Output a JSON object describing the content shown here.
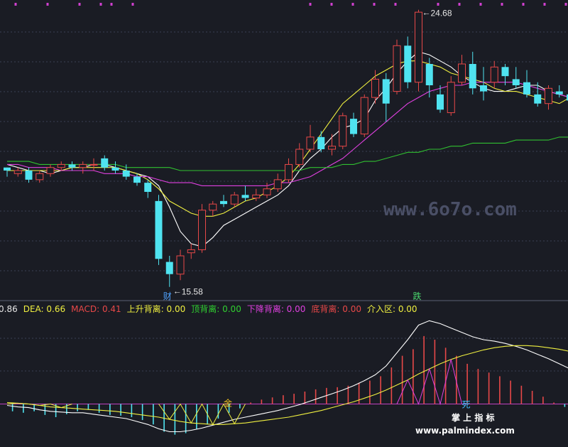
{
  "chart_data": [
    {
      "type": "candlestick",
      "title": "",
      "price_labels": {
        "high": "24.68",
        "low": "15.58"
      },
      "event_markers": [
        {
          "text": "财",
          "color": "#4fa3ff"
        },
        {
          "text": "跌",
          "color": "#4ad66d"
        }
      ],
      "ohlc": [
        [
          19.5,
          19.5,
          19.2,
          19.4
        ],
        [
          19.3,
          19.5,
          19.2,
          19.4
        ],
        [
          19.4,
          19.5,
          19.0,
          19.1
        ],
        [
          19.1,
          19.4,
          19.0,
          19.3
        ],
        [
          19.3,
          19.6,
          19.2,
          19.5
        ],
        [
          19.5,
          19.7,
          19.4,
          19.6
        ],
        [
          19.6,
          19.7,
          19.4,
          19.5
        ],
        [
          19.5,
          19.7,
          19.3,
          19.6
        ],
        [
          19.6,
          19.8,
          19.4,
          19.6
        ],
        [
          19.8,
          19.9,
          19.4,
          19.5
        ],
        [
          19.5,
          19.7,
          19.3,
          19.4
        ],
        [
          19.4,
          19.6,
          19.1,
          19.2
        ],
        [
          19.2,
          19.3,
          18.9,
          19.0
        ],
        [
          19.0,
          19.1,
          18.5,
          18.7
        ],
        [
          18.4,
          18.6,
          16.3,
          16.5
        ],
        [
          16.4,
          16.6,
          15.58,
          16.0
        ],
        [
          16.0,
          16.8,
          15.8,
          16.6
        ],
        [
          16.7,
          17.0,
          16.5,
          16.8
        ],
        [
          16.8,
          18.3,
          16.7,
          18.1
        ],
        [
          18.1,
          18.4,
          17.9,
          18.3
        ],
        [
          18.4,
          18.6,
          18.2,
          18.3
        ],
        [
          18.3,
          18.7,
          18.2,
          18.6
        ],
        [
          18.6,
          18.9,
          18.4,
          18.5
        ],
        [
          18.5,
          18.8,
          18.4,
          18.6
        ],
        [
          18.6,
          19.0,
          18.5,
          18.8
        ],
        [
          18.8,
          19.3,
          18.7,
          19.1
        ],
        [
          19.1,
          19.8,
          19.0,
          19.6
        ],
        [
          19.6,
          20.3,
          19.5,
          20.1
        ],
        [
          20.1,
          20.9,
          20.0,
          20.5
        ],
        [
          20.5,
          20.7,
          20.0,
          20.1
        ],
        [
          20.1,
          20.6,
          19.9,
          20.2
        ],
        [
          20.2,
          21.3,
          20.1,
          21.2
        ],
        [
          21.1,
          21.3,
          20.5,
          20.6
        ],
        [
          20.6,
          21.9,
          20.5,
          21.8
        ],
        [
          21.8,
          22.7,
          21.6,
          22.4
        ],
        [
          22.4,
          22.6,
          21.0,
          21.6
        ],
        [
          22.0,
          23.7,
          21.9,
          23.5
        ],
        [
          23.5,
          23.8,
          22.1,
          22.3
        ],
        [
          22.3,
          24.68,
          22.0,
          24.6
        ],
        [
          22.9,
          23.1,
          21.8,
          22.2
        ],
        [
          21.9,
          22.2,
          21.3,
          21.4
        ],
        [
          21.3,
          22.5,
          21.2,
          22.3
        ],
        [
          22.3,
          23.2,
          22.2,
          22.9
        ],
        [
          22.9,
          23.3,
          21.9,
          22.1
        ],
        [
          22.2,
          22.8,
          21.7,
          22.0
        ],
        [
          22.3,
          23.0,
          22.1,
          22.8
        ],
        [
          22.8,
          22.9,
          22.2,
          22.5
        ],
        [
          22.4,
          22.8,
          22.1,
          22.2
        ],
        [
          22.3,
          22.7,
          21.8,
          21.9
        ],
        [
          21.9,
          22.3,
          21.5,
          21.6
        ],
        [
          21.6,
          22.2,
          21.4,
          22.1
        ],
        [
          22.0,
          22.2,
          21.8,
          21.9
        ],
        [
          21.9,
          22.2,
          21.6,
          21.7
        ],
        [
          21.6,
          22.0,
          21.5,
          21.8
        ],
        [
          21.6,
          21.8,
          21.4,
          21.5
        ],
        [
          21.5,
          21.7,
          21.4,
          21.7
        ],
        [
          21.7,
          22.8,
          21.6,
          22.7
        ]
      ],
      "series": [
        {
          "color": "#ffffff",
          "values": [
            19.6,
            19.5,
            19.4,
            19.4,
            19.3,
            19.4,
            19.5,
            19.5,
            19.6,
            19.6,
            19.5,
            19.4,
            19.3,
            19.2,
            18.9,
            18.2,
            17.4,
            17.0,
            16.9,
            17.2,
            17.6,
            17.8,
            18.0,
            18.2,
            18.4,
            18.6,
            18.9,
            19.4,
            19.8,
            20.1,
            20.5,
            20.8,
            20.9,
            21.1,
            21.7,
            22.1,
            22.6,
            23.0,
            23.3,
            23.2,
            23.0,
            22.8,
            22.5,
            22.3,
            22.1,
            22.0,
            22.0,
            22.1,
            22.2,
            22.2,
            22.0,
            21.9,
            21.8,
            21.8,
            21.7,
            21.7,
            21.8
          ]
        },
        {
          "color": "#f0f040",
          "values": [
            19.4,
            19.4,
            19.4,
            19.4,
            19.4,
            19.4,
            19.5,
            19.5,
            19.5,
            19.5,
            19.5,
            19.4,
            19.3,
            19.1,
            18.8,
            18.4,
            18.2,
            18.0,
            17.9,
            17.9,
            18.0,
            18.2,
            18.4,
            18.5,
            18.7,
            18.9,
            19.2,
            19.6,
            20.1,
            20.6,
            21.1,
            21.6,
            21.9,
            22.2,
            22.5,
            22.7,
            22.9,
            23.0,
            23.0,
            22.9,
            22.8,
            22.6,
            22.5,
            22.4,
            22.3,
            22.1,
            22.0,
            22.0,
            21.9,
            21.8,
            21.7,
            21.6,
            21.8,
            21.9,
            22.0,
            22.1,
            22.1
          ]
        },
        {
          "color": "#e040e0",
          "values": [
            19.6,
            19.6,
            19.5,
            19.5,
            19.5,
            19.4,
            19.4,
            19.4,
            19.4,
            19.3,
            19.3,
            19.3,
            19.2,
            19.2,
            19.1,
            19.0,
            19.0,
            19.0,
            18.9,
            18.9,
            18.9,
            18.9,
            18.9,
            18.9,
            18.9,
            19.0,
            19.0,
            19.1,
            19.2,
            19.4,
            19.6,
            19.8,
            20.1,
            20.4,
            20.7,
            21.0,
            21.3,
            21.6,
            21.8,
            22.0,
            22.1,
            22.2,
            22.2,
            22.3,
            22.3,
            22.3,
            22.3,
            22.3,
            22.2,
            22.1,
            22.0,
            21.9,
            21.8,
            21.7,
            21.6,
            21.5,
            21.5
          ]
        },
        {
          "color": "#30c030",
          "values": [
            19.7,
            19.7,
            19.7,
            19.6,
            19.6,
            19.6,
            19.6,
            19.6,
            19.6,
            19.6,
            19.6,
            19.5,
            19.5,
            19.5,
            19.5,
            19.5,
            19.4,
            19.4,
            19.4,
            19.4,
            19.4,
            19.4,
            19.4,
            19.4,
            19.4,
            19.4,
            19.4,
            19.4,
            19.5,
            19.5,
            19.5,
            19.6,
            19.6,
            19.7,
            19.7,
            19.8,
            19.9,
            20.0,
            20.0,
            20.1,
            20.1,
            20.2,
            20.2,
            20.3,
            20.3,
            20.3,
            20.3,
            20.4,
            20.4,
            20.4,
            20.4,
            20.5,
            20.5,
            20.5,
            20.5,
            20.6,
            20.6
          ]
        }
      ],
      "ylim": [
        15.2,
        25.0
      ],
      "grid": true
    },
    {
      "type": "bar",
      "title": "",
      "indicator_legend": [
        {
          "text": "0.86",
          "color": "#e6e6e6"
        },
        {
          "text": "DEA: 0.66",
          "color": "#f0f040"
        },
        {
          "text": "MACD: 0.41",
          "color": "#e84848"
        },
        {
          "text": "上升背离: 0.00",
          "color": "#f0f040"
        },
        {
          "text": "顶背离: 0.00",
          "color": "#30d030"
        },
        {
          "text": "下降背离: 0.00",
          "color": "#e040e0"
        },
        {
          "text": "底背离: 0.00",
          "color": "#e84848"
        },
        {
          "text": "介入区: 0.00",
          "color": "#f0f040"
        }
      ],
      "markers": [
        {
          "text": "金",
          "color": "#f0c020"
        },
        {
          "text": "死",
          "color": "#40c0ff"
        }
      ],
      "macd_bars": [
        -0.1,
        -0.12,
        -0.1,
        -0.15,
        -0.18,
        -0.14,
        -0.1,
        -0.08,
        -0.12,
        -0.15,
        -0.16,
        -0.18,
        -0.22,
        -0.28,
        -0.38,
        -0.42,
        -0.4,
        -0.34,
        -0.28,
        -0.2,
        -0.12,
        -0.06,
        0.02,
        0.06,
        0.09,
        0.12,
        0.14,
        0.17,
        0.2,
        0.22,
        0.23,
        0.25,
        0.29,
        0.32,
        0.38,
        0.5,
        0.66,
        0.75,
        0.93,
        0.88,
        0.77,
        0.66,
        0.55,
        0.48,
        0.43,
        0.38,
        0.32,
        0.25,
        0.18,
        0.1,
        0.02,
        -0.04,
        -0.1,
        -0.16,
        -0.22,
        -0.28,
        -0.34
      ],
      "series": [
        {
          "name": "DIF",
          "color": "#ffffff",
          "values": [
            -0.02,
            -0.04,
            -0.05,
            -0.08,
            -0.1,
            -0.11,
            -0.12,
            -0.12,
            -0.14,
            -0.16,
            -0.18,
            -0.2,
            -0.24,
            -0.28,
            -0.34,
            -0.38,
            -0.38,
            -0.36,
            -0.33,
            -0.29,
            -0.25,
            -0.21,
            -0.18,
            -0.15,
            -0.12,
            -0.09,
            -0.05,
            -0.01,
            0.04,
            0.09,
            0.14,
            0.19,
            0.25,
            0.32,
            0.4,
            0.52,
            0.7,
            0.88,
            1.08,
            1.14,
            1.1,
            1.04,
            0.98,
            0.92,
            0.88,
            0.86,
            0.83,
            0.79,
            0.74,
            0.68,
            0.62,
            0.55,
            0.48,
            0.42,
            0.37,
            0.33,
            0.56
          ]
        },
        {
          "name": "DEA",
          "color": "#f0f040",
          "values": [
            0.02,
            0.01,
            0.0,
            -0.02,
            -0.04,
            -0.05,
            -0.06,
            -0.07,
            -0.08,
            -0.09,
            -0.1,
            -0.12,
            -0.14,
            -0.16,
            -0.18,
            -0.21,
            -0.24,
            -0.26,
            -0.27,
            -0.28,
            -0.28,
            -0.27,
            -0.26,
            -0.24,
            -0.22,
            -0.2,
            -0.18,
            -0.15,
            -0.12,
            -0.09,
            -0.05,
            -0.01,
            0.03,
            0.08,
            0.13,
            0.19,
            0.26,
            0.33,
            0.41,
            0.48,
            0.55,
            0.61,
            0.66,
            0.7,
            0.74,
            0.77,
            0.79,
            0.8,
            0.8,
            0.79,
            0.77,
            0.75,
            0.72,
            0.69,
            0.66,
            0.63,
            0.66
          ]
        }
      ],
      "ylim": [
        -0.55,
        1.25
      ]
    }
  ],
  "watermarks": {
    "faint": "www.6o7o.com",
    "brand_cn": "掌 上 指 标",
    "brand_url": "www.palmindex.com"
  }
}
